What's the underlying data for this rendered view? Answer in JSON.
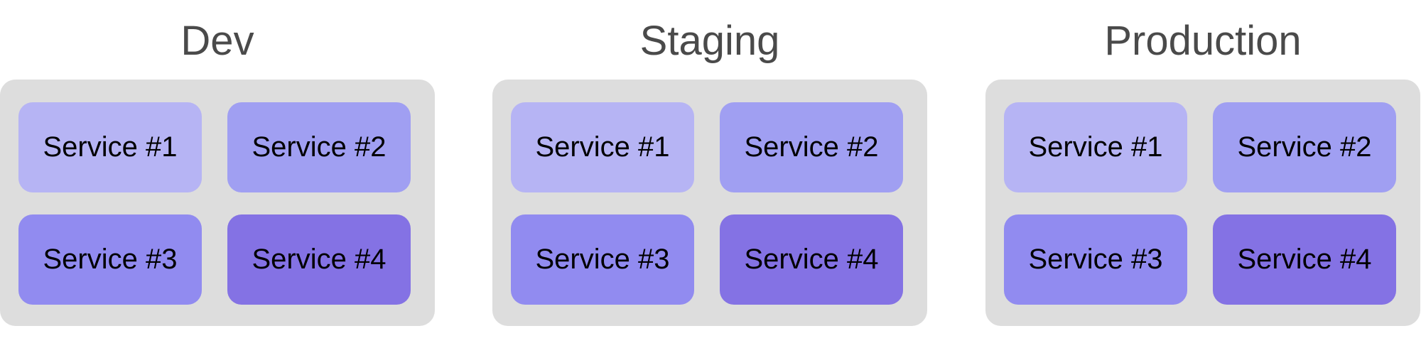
{
  "environments": [
    {
      "title": "Dev",
      "services": [
        {
          "label": "Service #1",
          "color": "#b6b4f4"
        },
        {
          "label": "Service #2",
          "color": "#a09ff2"
        },
        {
          "label": "Service #3",
          "color": "#918bf0"
        },
        {
          "label": "Service #4",
          "color": "#8472e4"
        }
      ]
    },
    {
      "title": "Staging",
      "services": [
        {
          "label": "Service #1",
          "color": "#b6b4f4"
        },
        {
          "label": "Service #2",
          "color": "#a09ff2"
        },
        {
          "label": "Service #3",
          "color": "#918bf0"
        },
        {
          "label": "Service #4",
          "color": "#8472e4"
        }
      ]
    },
    {
      "title": "Production",
      "services": [
        {
          "label": "Service #1",
          "color": "#b6b4f4"
        },
        {
          "label": "Service #2",
          "color": "#a09ff2"
        },
        {
          "label": "Service #3",
          "color": "#918bf0"
        },
        {
          "label": "Service #4",
          "color": "#8472e4"
        }
      ]
    }
  ],
  "colors": {
    "container_background": "#dddddd",
    "title_text": "#4a4a4a"
  }
}
